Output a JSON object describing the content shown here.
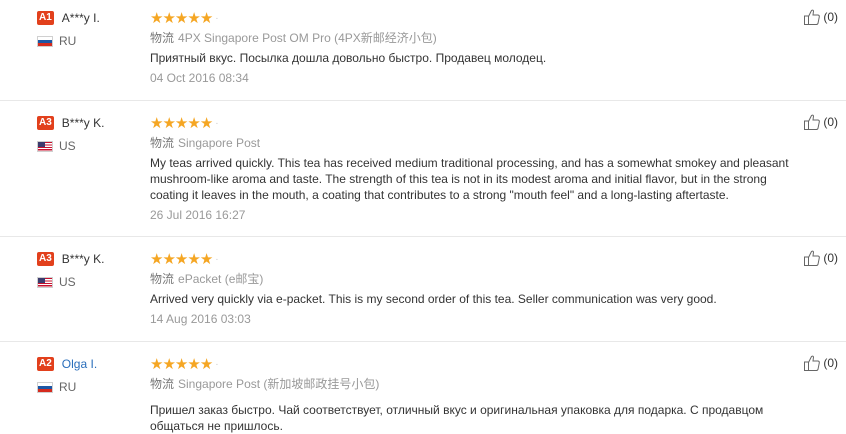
{
  "reviews": [
    {
      "level": "A1",
      "name": "A***y I.",
      "country": "RU",
      "flag": "ru",
      "rating": 5,
      "logistics_label": "物流",
      "logistics": "4PX Singapore Post OM Pro (4PX新邮经济小包)",
      "text": "Приятный вкус. Посылка дошла довольно быстро. Продавец молодец.",
      "date": "04 Oct 2016 08:34",
      "helpful": "(0)"
    },
    {
      "level": "A3",
      "name": "B***y K.",
      "country": "US",
      "flag": "us",
      "rating": 5,
      "logistics_label": "物流",
      "logistics": "Singapore Post",
      "text": "My teas arrived quickly. This tea has received medium traditional processing, and has a somewhat smokey and pleasant mushroom-like aroma and taste. The strength of this tea is not in its modest aroma and initial flavor, but in the strong coating it leaves in the mouth, a coating that contributes to a strong \"mouth feel\" and a long-lasting aftertaste.",
      "date": "26 Jul 2016 16:27",
      "helpful": "(0)"
    },
    {
      "level": "A3",
      "name": "B***y K.",
      "country": "US",
      "flag": "us",
      "rating": 5,
      "logistics_label": "物流",
      "logistics": "ePacket (e邮宝)",
      "text": "Arrived very quickly via e-packet. This is my second order of this tea. Seller communication was very good.",
      "date": "14 Aug 2016 03:03",
      "helpful": "(0)"
    },
    {
      "level": "A2",
      "name": "Olga I.",
      "country": "RU",
      "flag": "ru",
      "rating": 5,
      "logistics_label": "物流",
      "logistics": "Singapore Post (新加坡邮政挂号小包)",
      "text": "Пришел заказ быстро. Чай соответствует, отличный вкус и оригинальная упаковка для подарка. С продавцом общаться не пришлось.",
      "date": "",
      "helpful": "(0)"
    }
  ],
  "colors": {
    "badge": "#e2401c",
    "star": "#f5a623",
    "link": "#2a6ebb"
  }
}
